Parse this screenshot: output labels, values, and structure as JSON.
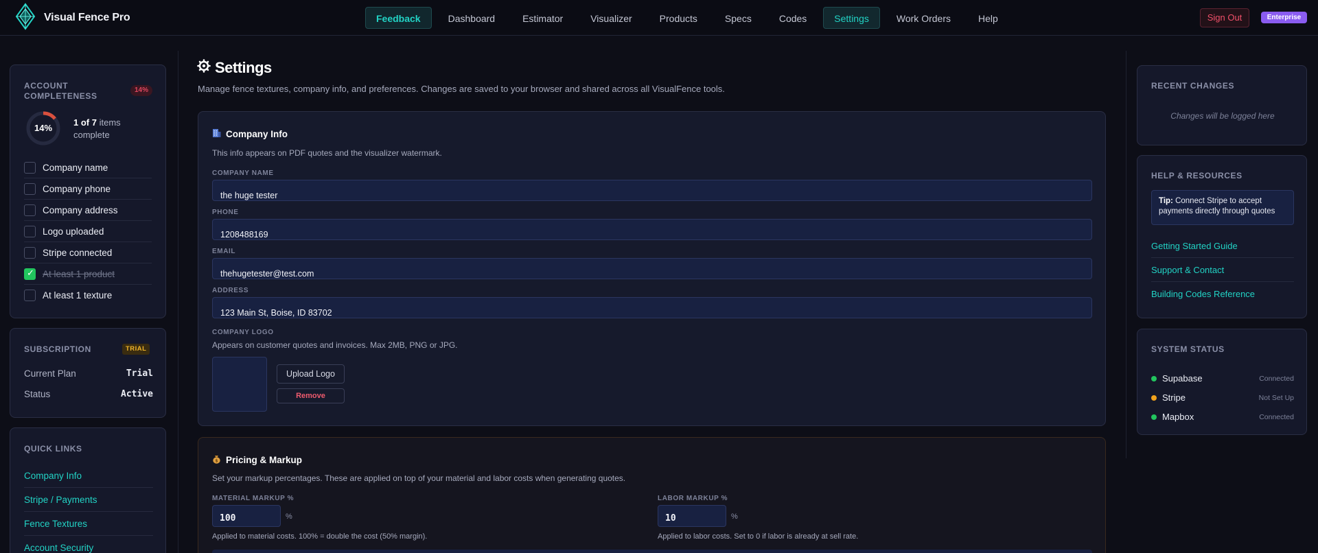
{
  "app": {
    "name": "Visual Fence Pro"
  },
  "nav": {
    "items": [
      "Feedback",
      "Dashboard",
      "Estimator",
      "Visualizer",
      "Products",
      "Specs",
      "Codes",
      "Settings",
      "Work Orders",
      "Help"
    ],
    "active": "Settings",
    "sign_out": "Sign Out",
    "plan_badge": "Enterprise"
  },
  "completeness": {
    "title": "ACCOUNT COMPLETENESS",
    "percent_label": "14%",
    "percent": 14,
    "done_count": "1 of 7",
    "summary_suffix": "items complete",
    "items": [
      {
        "label": "Company name",
        "checked": false
      },
      {
        "label": "Company phone",
        "checked": false
      },
      {
        "label": "Company address",
        "checked": false
      },
      {
        "label": "Logo uploaded",
        "checked": false
      },
      {
        "label": "Stripe connected",
        "checked": false
      },
      {
        "label": "At least 1 product",
        "checked": true
      },
      {
        "label": "At least 1 texture",
        "checked": false
      }
    ]
  },
  "subscription": {
    "title": "SUBSCRIPTION",
    "badge": "TRIAL",
    "plan_label": "Current Plan",
    "plan_value": "Trial",
    "status_label": "Status",
    "status_value": "Active"
  },
  "quick_links": {
    "title": "QUICK LINKS",
    "items": [
      "Company Info",
      "Stripe / Payments",
      "Fence Textures",
      "Account Security"
    ]
  },
  "page": {
    "icon": "gear-icon",
    "title": "Settings",
    "subtitle": "Manage fence textures, company info, and preferences. Changes are saved to your browser and shared across all VisualFence tools."
  },
  "company_info": {
    "icon": "building-icon",
    "title": "Company Info",
    "subtitle": "This info appears on PDF quotes and the visualizer watermark.",
    "name_label": "COMPANY NAME",
    "name_value": "the huge tester",
    "phone_label": "PHONE",
    "phone_value": "1208488169",
    "email_label": "EMAIL",
    "email_value": "thehugetester@test.com",
    "address_label": "ADDRESS",
    "address_value": "123 Main St, Boise, ID 83702",
    "logo_label": "COMPANY LOGO",
    "logo_hint": "Appears on customer quotes and invoices. Max 2MB, PNG or JPG.",
    "upload_label": "Upload Logo",
    "remove_label": "Remove"
  },
  "pricing": {
    "icon": "money-bag-icon",
    "title": "Pricing & Markup",
    "subtitle": "Set your markup percentages. These are applied on top of your material and labor costs when generating quotes.",
    "material_label": "MATERIAL MARKUP %",
    "material_value": "100",
    "material_hint": "Applied to material costs. 100% = double the cost (50% margin).",
    "labor_label": "LABOR MARKUP %",
    "labor_value": "10",
    "labor_hint": "Applied to labor costs. Set to 0 if labor is already at sell rate.",
    "percent_sign": "%"
  },
  "recent_changes": {
    "title": "RECENT CHANGES",
    "empty": "Changes will be logged here"
  },
  "help": {
    "title": "HELP & RESOURCES",
    "tip_bold": "Tip:",
    "tip_text": "Connect Stripe to accept payments directly through quotes",
    "links": [
      "Getting Started Guide",
      "Support & Contact",
      "Building Codes Reference"
    ]
  },
  "system_status": {
    "title": "SYSTEM STATUS",
    "services": [
      {
        "name": "Supabase",
        "state": "Connected",
        "color": "#22c55e"
      },
      {
        "name": "Stripe",
        "state": "Not Set Up",
        "color": "#f0a21c"
      },
      {
        "name": "Mapbox",
        "state": "Connected",
        "color": "#22c55e"
      }
    ]
  },
  "colors": {
    "accent": "#22d3c5",
    "danger": "#f0506a",
    "success": "#22c55e",
    "warning": "#f0b429",
    "enterprise": "#8a5cf0"
  }
}
